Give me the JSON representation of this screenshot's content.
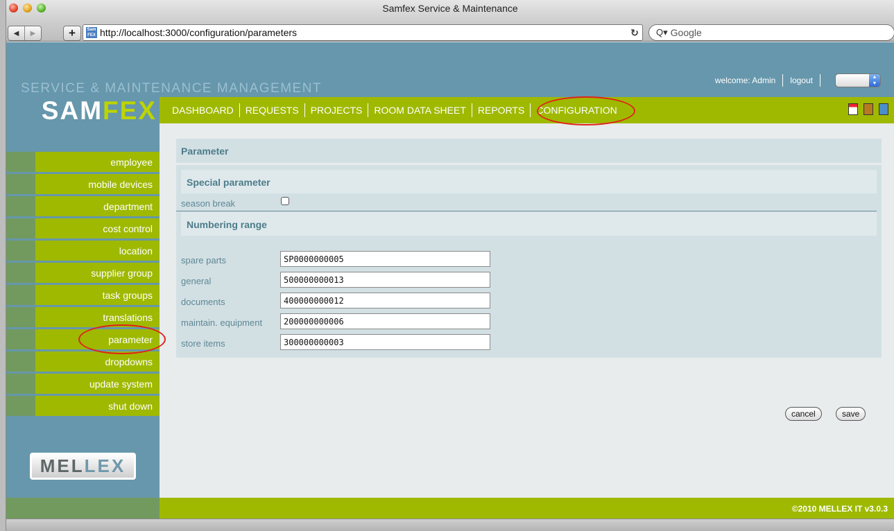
{
  "browser": {
    "title": "Samfex Service & Maintenance",
    "url": "http://localhost:3000/configuration/parameters",
    "search_placeholder": "Google",
    "back_icon": "back-arrow",
    "forward_icon": "forward-arrow",
    "add_bookmark": "+"
  },
  "header": {
    "subtitle": "SERVICE & MAINTENANCE MANAGEMENT",
    "logo_part1": "SAM",
    "logo_part2": "FEX",
    "welcome": "welcome: Admin",
    "logout": "logout",
    "language_selected": ""
  },
  "nav": {
    "items": [
      "DASHBOARD",
      "REQUESTS",
      "PROJECTS",
      "ROOM DATA SHEET",
      "REPORTS",
      "CONFIGURATION"
    ],
    "active": "CONFIGURATION",
    "icons": [
      "calendar-icon",
      "book-icon",
      "phone-icon"
    ]
  },
  "sidebar": {
    "items": [
      "employee",
      "mobile devices",
      "department",
      "cost control",
      "location",
      "supplier group",
      "task groups",
      "translations",
      "parameter",
      "dropdowns",
      "update system",
      "shut down"
    ],
    "active": "parameter",
    "brand_part1": "MEL",
    "brand_part2": "LEX"
  },
  "content": {
    "panel_title": "Parameter",
    "special_title": "Special parameter",
    "season_break_label": "season break",
    "season_break_checked": false,
    "numbering_title": "Numbering range",
    "fields": [
      {
        "label": "spare parts",
        "value": "SP0000000005"
      },
      {
        "label": "general",
        "value": "500000000013"
      },
      {
        "label": "documents",
        "value": "400000000012"
      },
      {
        "label": "maintain. equipment",
        "value": "200000000006"
      },
      {
        "label": "store items",
        "value": "300000000003"
      }
    ],
    "cancel": "cancel",
    "save": "save"
  },
  "footer": {
    "copyright": "©2010 MELLEX IT v3.0.3"
  },
  "colors": {
    "header_blue": "#6697ac",
    "nav_green": "#9fb900",
    "stub_green": "#729a5f",
    "panel": "#d2e0e4",
    "annotation_red": "#e0231a"
  }
}
